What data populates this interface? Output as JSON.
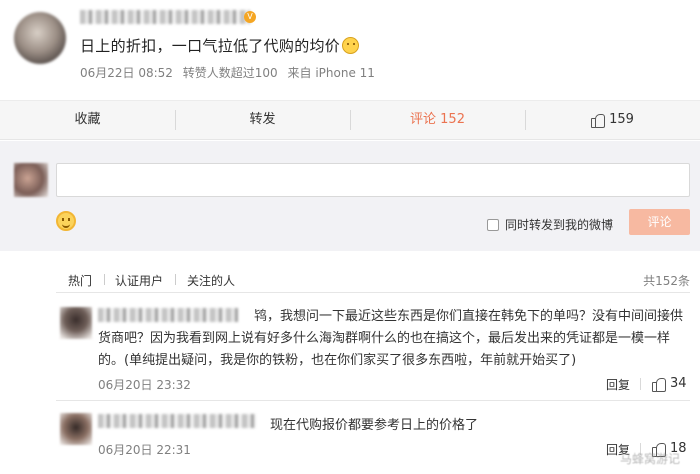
{
  "post": {
    "text": "日上的折扣，一口气拉低了代购的均价",
    "date": "06月22日 08:52",
    "reposts": "转赞人数超过100",
    "source": "来自 iPhone 11"
  },
  "actions": {
    "favorite": "收藏",
    "repost": "转发",
    "comment": "评论 152",
    "likes": "159"
  },
  "compose": {
    "forward_label": "同时转发到我的微博",
    "submit_label": "评论"
  },
  "filters": {
    "hot": "热门",
    "verified": "认证用户",
    "following": "关注的人",
    "total": "共152条"
  },
  "comments": [
    {
      "text": "鸨，我想问一下最近这些东西是你们直接在韩免下的单吗？没有中间间接供货商吧？因为我看到网上说有好多什么海淘群啊什么的也在搞这个，最后发出来的凭证都是一模一样的。(单纯提出疑问，我是你的铁粉，也在你们家买了很多东西啦，年前就开始买了)",
      "date": "06月20日 23:32",
      "reply": "回复",
      "likes": "34"
    },
    {
      "text": "现在代购报价都要参考日上的价格了",
      "date": "06月20日 22:31",
      "reply": "回复",
      "likes": "18"
    }
  ],
  "watermark": "马蜂窝游记"
}
